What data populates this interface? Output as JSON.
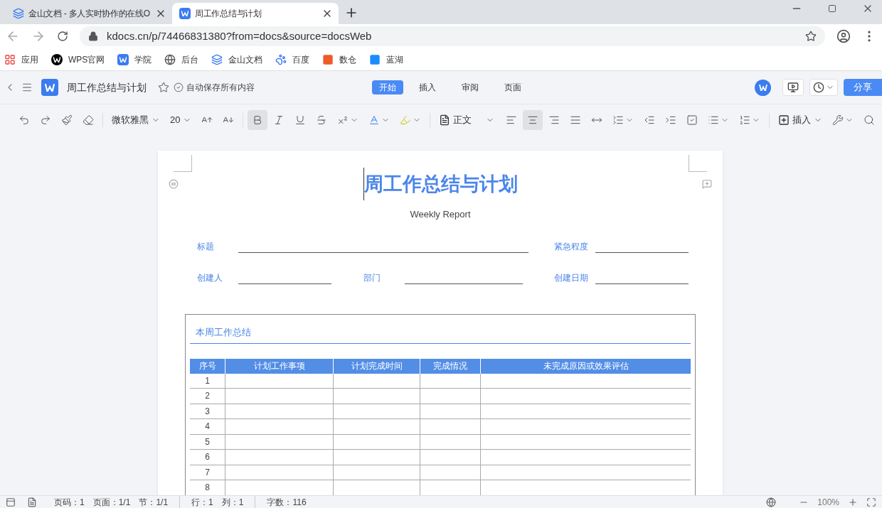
{
  "browser": {
    "tabs": [
      {
        "title": "金山文档 - 多人实时协作的在线O",
        "selected": false
      },
      {
        "title": "周工作总结与计划",
        "selected": true
      }
    ],
    "url": "kdocs.cn/p/74466831380?from=docs&source=docsWeb",
    "bookmarks": [
      {
        "label": "应用",
        "kind": "apps"
      },
      {
        "label": "WPS官网",
        "kind": "wps"
      },
      {
        "label": "学院",
        "kind": "academy"
      },
      {
        "label": "后台",
        "kind": "globe"
      },
      {
        "label": "金山文档",
        "kind": "docs"
      },
      {
        "label": "百度",
        "kind": "paw"
      },
      {
        "label": "数仓",
        "kind": "warehouse"
      },
      {
        "label": "蓝湖",
        "kind": "lake"
      }
    ]
  },
  "app": {
    "title": "周工作总结与计划",
    "autosave": "自动保存所有内容",
    "menu_tabs": [
      {
        "label": "开始",
        "selected": true
      },
      {
        "label": "插入",
        "selected": false
      },
      {
        "label": "审阅",
        "selected": false
      },
      {
        "label": "页面",
        "selected": false
      }
    ],
    "share_button": "分享"
  },
  "toolbar": [
    {
      "kind": "undo",
      "selected": false
    },
    {
      "kind": "redo",
      "selected": false
    },
    {
      "kind": "painter",
      "selected": false
    },
    {
      "kind": "eraser",
      "selected": false
    },
    {
      "kind": "sep"
    },
    {
      "kind": "font",
      "label": "微软雅黑"
    },
    {
      "kind": "size",
      "label": "20"
    },
    {
      "kind": "grow",
      "selected": false
    },
    {
      "kind": "shrink",
      "selected": false
    },
    {
      "kind": "sep"
    },
    {
      "kind": "bold",
      "selected": true
    },
    {
      "kind": "italic",
      "selected": false
    },
    {
      "kind": "underline",
      "selected": false
    },
    {
      "kind": "strike",
      "selected": false
    },
    {
      "kind": "superscript",
      "selected": false
    },
    {
      "kind": "color",
      "selected": false
    },
    {
      "kind": "highlight",
      "selected": false
    },
    {
      "kind": "sep"
    },
    {
      "kind": "style",
      "label": "正文"
    },
    {
      "kind": "align-left",
      "selected": false
    },
    {
      "kind": "align-center",
      "selected": true
    },
    {
      "kind": "align-right",
      "selected": false
    },
    {
      "kind": "justify",
      "selected": false
    },
    {
      "kind": "spacing",
      "selected": false
    },
    {
      "kind": "line-spacing",
      "selected": false
    },
    {
      "kind": "outdent",
      "selected": false
    },
    {
      "kind": "indent",
      "selected": false
    },
    {
      "kind": "checkbox",
      "selected": false
    },
    {
      "kind": "bullets",
      "selected": false
    },
    {
      "kind": "numbering",
      "selected": false
    },
    {
      "kind": "sep"
    },
    {
      "kind": "insert",
      "label": "插入"
    },
    {
      "kind": "tools",
      "selected": false
    },
    {
      "kind": "search",
      "selected": false
    }
  ],
  "document": {
    "title": "周工作总结与计划",
    "subtitle": "Weekly Report",
    "fields": [
      [
        {
          "label": "标题",
          "kind": "wide"
        },
        {
          "label": "紧急程度",
          "kind": "short"
        }
      ],
      [
        {
          "label": "创建人",
          "kind": "short"
        },
        {
          "label": "部门",
          "kind": "medium"
        },
        {
          "label": "创建日期",
          "kind": "short"
        }
      ]
    ],
    "section": {
      "heading": "本周工作总结",
      "table": {
        "columns": [
          "序号",
          "计划工作事项",
          "计划完成时间",
          "完成情况",
          "未完成原因或效果评估"
        ],
        "rows": [
          "1",
          "2",
          "3",
          "4",
          "5",
          "6",
          "7",
          "8"
        ]
      }
    }
  },
  "status_bar": {
    "groups": [
      [
        "页码：1",
        "页面：1/1",
        "节：1/1"
      ],
      [
        "行：1",
        "列：1"
      ],
      [
        "字数：116"
      ]
    ],
    "zoom": "100%"
  }
}
